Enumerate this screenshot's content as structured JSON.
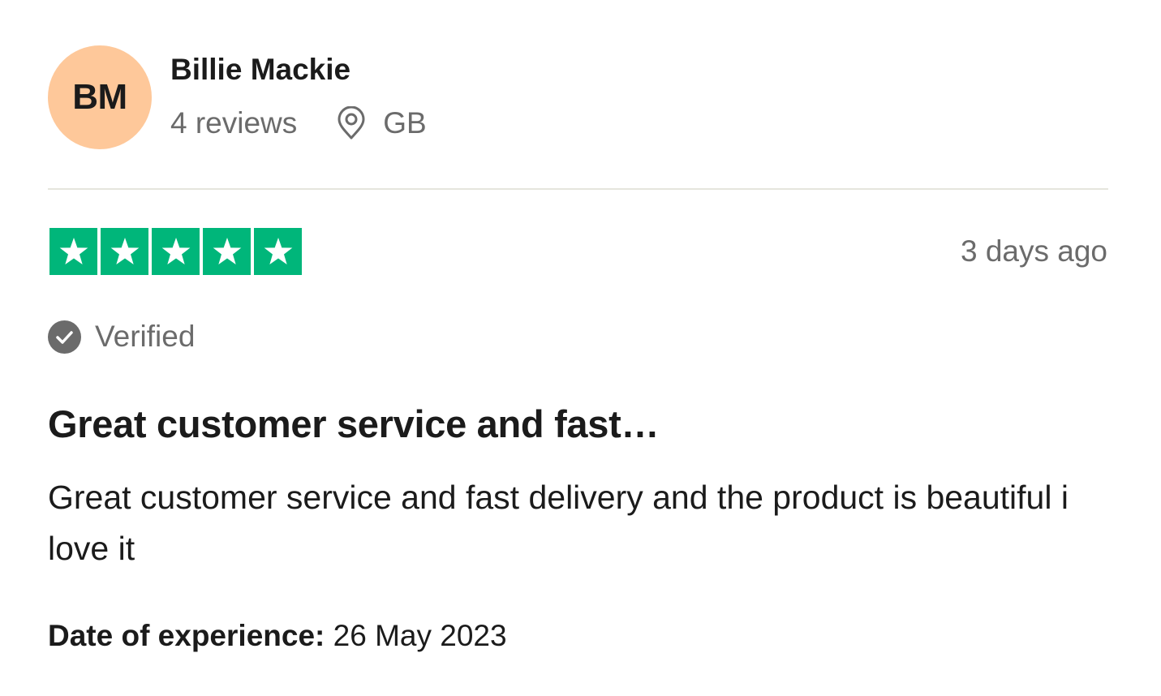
{
  "reviewer": {
    "initials": "BM",
    "avatar_color": "#fec89a",
    "name": "Billie Mackie",
    "review_count": "4 reviews",
    "location_icon": "location-pin-icon",
    "country": "GB"
  },
  "rating": {
    "stars": 5,
    "max_stars": 5,
    "star_color": "#00b67a",
    "star_icon": "star-icon"
  },
  "review": {
    "time_ago": "3 days ago",
    "verified_icon": "check-circle-icon",
    "verified_label": "Verified",
    "title": "Great customer service and fast…",
    "body": "Great customer service and fast delivery and the product is beautiful i love it",
    "experience_label": "Date of experience:",
    "experience_date": "26 May 2023"
  }
}
